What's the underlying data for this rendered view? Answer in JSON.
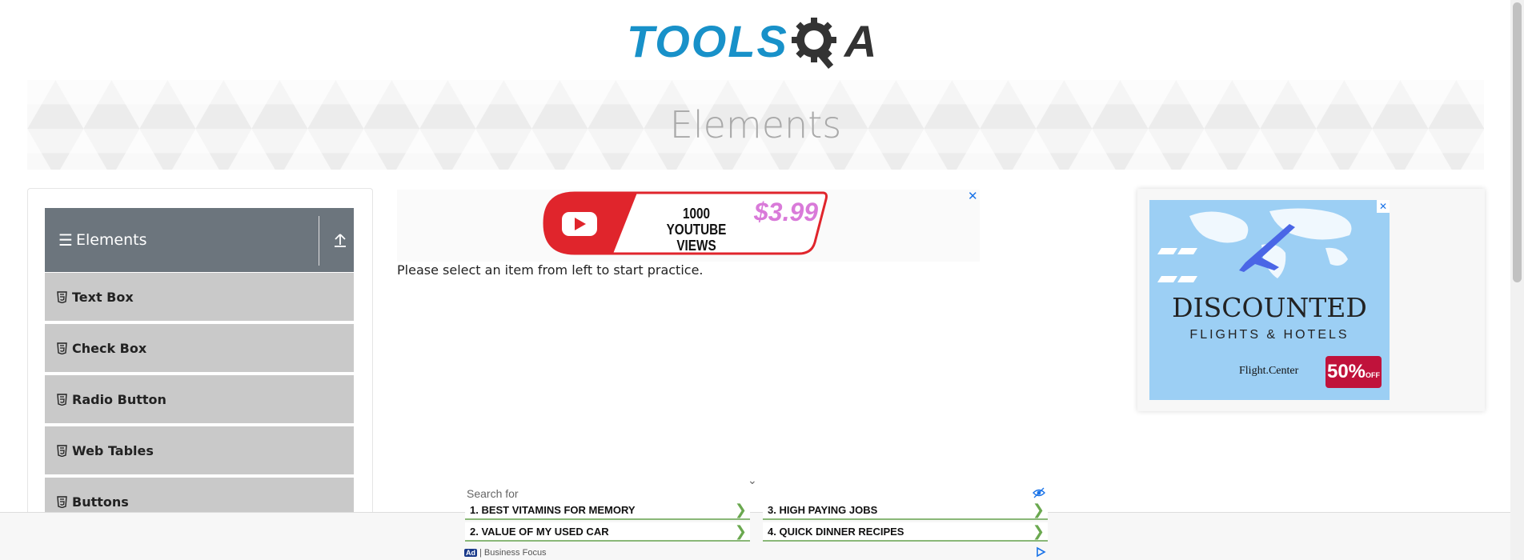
{
  "logo": {
    "part1": "TOOLS",
    "part2": "A"
  },
  "banner": {
    "title": "Elements"
  },
  "sidebar": {
    "group_title": "Elements",
    "items": [
      {
        "label": "Text Box"
      },
      {
        "label": "Check Box"
      },
      {
        "label": "Radio Button"
      },
      {
        "label": "Web Tables"
      },
      {
        "label": "Buttons"
      }
    ]
  },
  "main": {
    "message": "Please select an item from left to start practice."
  },
  "top_ad": {
    "views_line1": "1000",
    "views_line2": "YOUTUBE VIEWS",
    "price": "$3.99",
    "close": "✕"
  },
  "right_ad": {
    "headline": "DISCOUNTED",
    "subline": "FLIGHTS & HOTELS",
    "brand": "Flight.Center",
    "discount": "50%",
    "off": "OFF",
    "close": "✕"
  },
  "bottom_ad": {
    "search_for": "Search for",
    "links": [
      {
        "label": "1. BEST VITAMINS FOR MEMORY"
      },
      {
        "label": "2. VALUE OF MY USED CAR"
      },
      {
        "label": "3. HIGH PAYING JOBS"
      },
      {
        "label": "4. QUICK DINNER RECIPES"
      }
    ],
    "ad_label": "Ad",
    "sponsor": "| Business Focus"
  },
  "colors": {
    "brand_blue": "#1891c9",
    "header_gray": "#6c757d",
    "menu_item_bg": "#c9c9c9",
    "link_green": "#6aa84f"
  }
}
